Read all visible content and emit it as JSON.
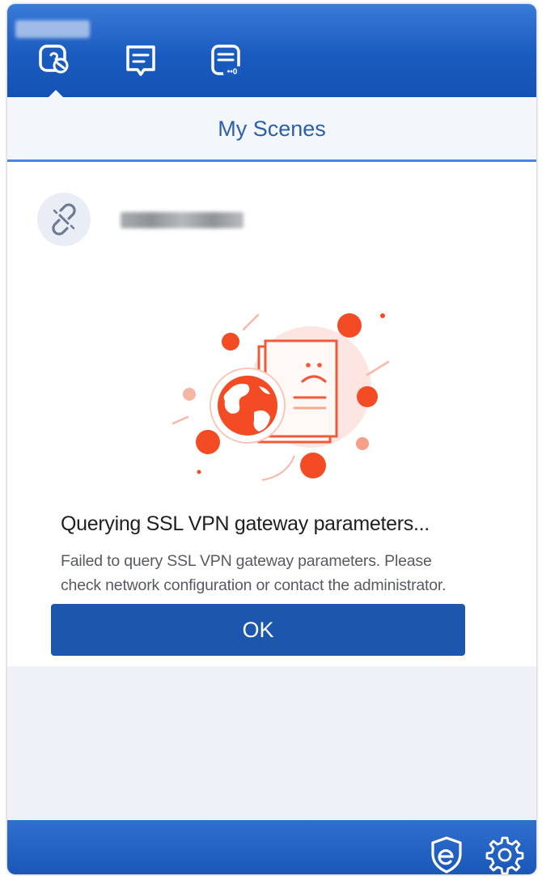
{
  "nav": {
    "tabs": [
      {
        "icon": "link-scene-icon",
        "active": true
      },
      {
        "icon": "message-icon",
        "active": false
      },
      {
        "icon": "message-list-icon",
        "active": false
      }
    ]
  },
  "header": {
    "title": "My Scenes"
  },
  "scene": {
    "icon": "broken-link-icon"
  },
  "dialog": {
    "illustration": "globe-error-document-icon",
    "title": "Querying SSL VPN gateway parameters...",
    "message_line1": "Failed to query SSL VPN gateway parameters. Please",
    "message_line2": "check network configuration or contact the administrator.",
    "ok_label": "OK"
  },
  "footer": {
    "icons": [
      "shield-e-icon",
      "gear-icon"
    ]
  },
  "colors": {
    "brand_blue": "#1c56ad",
    "accent_orange": "#f04a1f",
    "header_text": "#2b5fa9"
  }
}
